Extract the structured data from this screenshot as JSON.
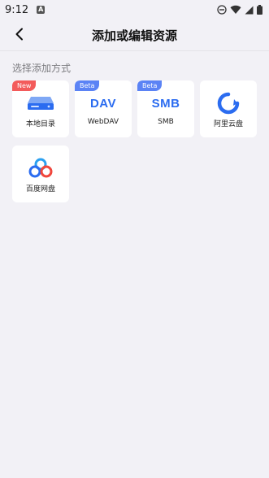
{
  "status_bar": {
    "time": "9:12",
    "notification_icon_letter": "A",
    "icons": [
      "notification-a-icon",
      "do-not-disturb-icon",
      "wifi-icon",
      "signal-icon",
      "battery-icon"
    ]
  },
  "header": {
    "title": "添加或编辑资源",
    "back_icon": "chevron-left-icon"
  },
  "section": {
    "label": "选择添加方式"
  },
  "sources": [
    {
      "label": "本地目录",
      "badge": "New",
      "badge_color": "#f35b5b",
      "icon": "hard-drive-icon"
    },
    {
      "label": "WebDAV",
      "badge": "Beta",
      "badge_color": "#5b83f5",
      "icon": "webdav-icon",
      "logo_text": "DAV"
    },
    {
      "label": "SMB",
      "badge": "Beta",
      "badge_color": "#5b83f5",
      "icon": "smb-icon",
      "logo_text": "SMB"
    },
    {
      "label": "阿里云盘",
      "badge": "",
      "icon": "aliyun-drive-icon"
    },
    {
      "label": "百度网盘",
      "badge": "",
      "icon": "baidu-netdisk-icon"
    }
  ],
  "colors": {
    "background": "#f2f1f6",
    "card": "#ffffff",
    "accent_blue": "#2b6cf0",
    "badge_new": "#f35b5b",
    "badge_beta": "#5b83f5"
  }
}
